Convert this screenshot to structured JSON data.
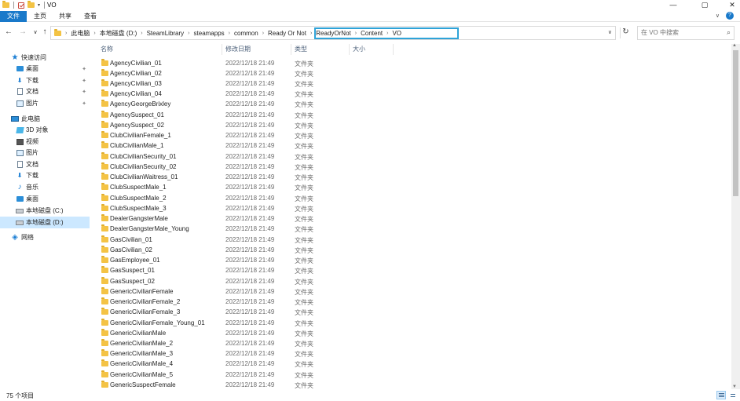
{
  "window": {
    "title": "VO",
    "controls": {
      "minimize": "—",
      "maximize": "▢",
      "close": "✕"
    }
  },
  "ribbon": {
    "tabs": [
      "文件",
      "主页",
      "共享",
      "查看"
    ],
    "expand_icon": "chevron-down",
    "help_label": "?"
  },
  "nav": {
    "back": "←",
    "forward": "→",
    "recent": "∨",
    "up": "↑"
  },
  "address": {
    "breadcrumbs": [
      "此电脑",
      "本地磁盘 (D:)",
      "SteamLibrary",
      "steamapps",
      "common",
      "Ready Or Not",
      "ReadyOrNot",
      "Content",
      "VO"
    ],
    "highlight_color": "#2fa3d8"
  },
  "search": {
    "placeholder": "在 VO 中搜索"
  },
  "sidebar": {
    "items": [
      {
        "label": "快速访问",
        "icon": "star-icon"
      },
      {
        "label": "桌面",
        "icon": "desktop-icon",
        "pinned": true
      },
      {
        "label": "下载",
        "icon": "download-icon",
        "pinned": true
      },
      {
        "label": "文档",
        "icon": "document-icon",
        "pinned": true
      },
      {
        "label": "图片",
        "icon": "pictures-icon",
        "pinned": true
      },
      {
        "label": "此电脑",
        "icon": "computer-icon"
      },
      {
        "label": "3D 对象",
        "icon": "3d-objects-icon"
      },
      {
        "label": "视频",
        "icon": "video-icon"
      },
      {
        "label": "图片",
        "icon": "pictures-icon"
      },
      {
        "label": "文档",
        "icon": "document-icon"
      },
      {
        "label": "下载",
        "icon": "download-icon"
      },
      {
        "label": "音乐",
        "icon": "music-icon"
      },
      {
        "label": "桌面",
        "icon": "desktop-icon"
      },
      {
        "label": "本地磁盘 (C:)",
        "icon": "drive-icon"
      },
      {
        "label": "本地磁盘 (D:)",
        "icon": "drive-icon",
        "selected": true
      },
      {
        "label": "网络",
        "icon": "network-icon"
      }
    ]
  },
  "columns": [
    "名称",
    "修改日期",
    "类型",
    "大小"
  ],
  "files": [
    {
      "name": "AgencyCivilian_01",
      "date": "2022/12/18 21:49",
      "type": "文件夹"
    },
    {
      "name": "AgencyCivilian_02",
      "date": "2022/12/18 21:49",
      "type": "文件夹"
    },
    {
      "name": "AgencyCivilian_03",
      "date": "2022/12/18 21:49",
      "type": "文件夹"
    },
    {
      "name": "AgencyCivilian_04",
      "date": "2022/12/18 21:49",
      "type": "文件夹"
    },
    {
      "name": "AgencyGeorgeBrixley",
      "date": "2022/12/18 21:49",
      "type": "文件夹"
    },
    {
      "name": "AgencySuspect_01",
      "date": "2022/12/18 21:49",
      "type": "文件夹"
    },
    {
      "name": "AgencySuspect_02",
      "date": "2022/12/18 21:49",
      "type": "文件夹"
    },
    {
      "name": "ClubCivilianFemale_1",
      "date": "2022/12/18 21:49",
      "type": "文件夹"
    },
    {
      "name": "ClubCivilianMale_1",
      "date": "2022/12/18 21:49",
      "type": "文件夹"
    },
    {
      "name": "ClubCivilianSecurity_01",
      "date": "2022/12/18 21:49",
      "type": "文件夹"
    },
    {
      "name": "ClubCivilianSecurity_02",
      "date": "2022/12/18 21:49",
      "type": "文件夹"
    },
    {
      "name": "ClubCivilianWaitress_01",
      "date": "2022/12/18 21:49",
      "type": "文件夹"
    },
    {
      "name": "ClubSuspectMale_1",
      "date": "2022/12/18 21:49",
      "type": "文件夹"
    },
    {
      "name": "ClubSuspectMale_2",
      "date": "2022/12/18 21:49",
      "type": "文件夹"
    },
    {
      "name": "ClubSuspectMale_3",
      "date": "2022/12/18 21:49",
      "type": "文件夹"
    },
    {
      "name": "DealerGangsterMale",
      "date": "2022/12/18 21:49",
      "type": "文件夹"
    },
    {
      "name": "DealerGangsterMale_Young",
      "date": "2022/12/18 21:49",
      "type": "文件夹"
    },
    {
      "name": "GasCivilian_01",
      "date": "2022/12/18 21:49",
      "type": "文件夹"
    },
    {
      "name": "GasCivilian_02",
      "date": "2022/12/18 21:49",
      "type": "文件夹"
    },
    {
      "name": "GasEmployee_01",
      "date": "2022/12/18 21:49",
      "type": "文件夹"
    },
    {
      "name": "GasSuspect_01",
      "date": "2022/12/18 21:49",
      "type": "文件夹"
    },
    {
      "name": "GasSuspect_02",
      "date": "2022/12/18 21:49",
      "type": "文件夹"
    },
    {
      "name": "GenericCivilianFemale",
      "date": "2022/12/18 21:49",
      "type": "文件夹"
    },
    {
      "name": "GenericCivilianFemale_2",
      "date": "2022/12/18 21:49",
      "type": "文件夹"
    },
    {
      "name": "GenericCivilianFemale_3",
      "date": "2022/12/18 21:49",
      "type": "文件夹"
    },
    {
      "name": "GenericCivilianFemale_Young_01",
      "date": "2022/12/18 21:49",
      "type": "文件夹"
    },
    {
      "name": "GenericCivilianMale",
      "date": "2022/12/18 21:49",
      "type": "文件夹"
    },
    {
      "name": "GenericCivilianMale_2",
      "date": "2022/12/18 21:49",
      "type": "文件夹"
    },
    {
      "name": "GenericCivilianMale_3",
      "date": "2022/12/18 21:49",
      "type": "文件夹"
    },
    {
      "name": "GenericCivilianMale_4",
      "date": "2022/12/18 21:49",
      "type": "文件夹"
    },
    {
      "name": "GenericCivilianMale_5",
      "date": "2022/12/18 21:49",
      "type": "文件夹"
    },
    {
      "name": "GenericSuspectFemale",
      "date": "2022/12/18 21:49",
      "type": "文件夹"
    }
  ],
  "status": {
    "item_count": "75 个项目"
  }
}
